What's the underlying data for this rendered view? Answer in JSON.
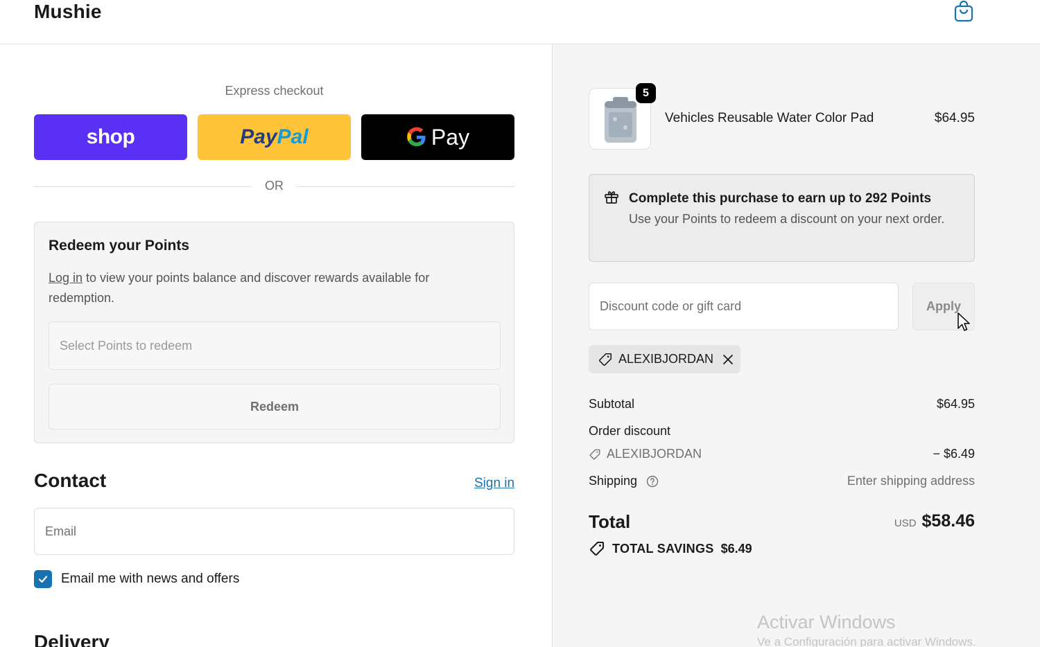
{
  "header": {
    "brand": "Mushie",
    "cart_icon": "shopping-bag-icon"
  },
  "express": {
    "label": "Express checkout",
    "shop_label": "shop",
    "paypal_part1": "Pay",
    "paypal_part2": "Pal",
    "gpay_label": "Pay",
    "or_label": "OR"
  },
  "redeem": {
    "title": "Redeem your Points",
    "login_link": "Log in",
    "description": " to view your points balance and discover rewards available for redemption.",
    "select_placeholder": "Select Points to redeem",
    "button_label": "Redeem"
  },
  "contact": {
    "title": "Contact",
    "sign_in": "Sign in",
    "email_placeholder": "Email",
    "newsletter_label": "Email me with news and offers",
    "newsletter_checked": true
  },
  "delivery": {
    "title": "Delivery"
  },
  "order": {
    "item": {
      "quantity": "5",
      "name": "Vehicles Reusable Water Color Pad",
      "price": "$64.95"
    },
    "points": {
      "title": "Complete this purchase to earn up to 292 Points",
      "description": "Use your Points to redeem a discount on your next order."
    },
    "discount": {
      "placeholder": "Discount code or gift card",
      "apply_label": "Apply",
      "applied_code": "ALEXIBJORDAN"
    },
    "summary": {
      "subtotal_label": "Subtotal",
      "subtotal_value": "$64.95",
      "order_discount_label": "Order discount",
      "discount_code": "ALEXIBJORDAN",
      "discount_value": "− $6.49",
      "shipping_label": "Shipping",
      "shipping_value": "Enter shipping address",
      "total_label": "Total",
      "currency": "USD",
      "total_value": "$58.46",
      "savings_label": "TOTAL SAVINGS",
      "savings_value": "$6.49"
    }
  },
  "watermark": {
    "line1": "Activar Windows",
    "line2": "Ve a Configuración para activar Windows."
  },
  "colors": {
    "accent": "#1773b0",
    "shop": "#5a31f4",
    "paypal": "#ffc439",
    "gpay": "#000000"
  }
}
